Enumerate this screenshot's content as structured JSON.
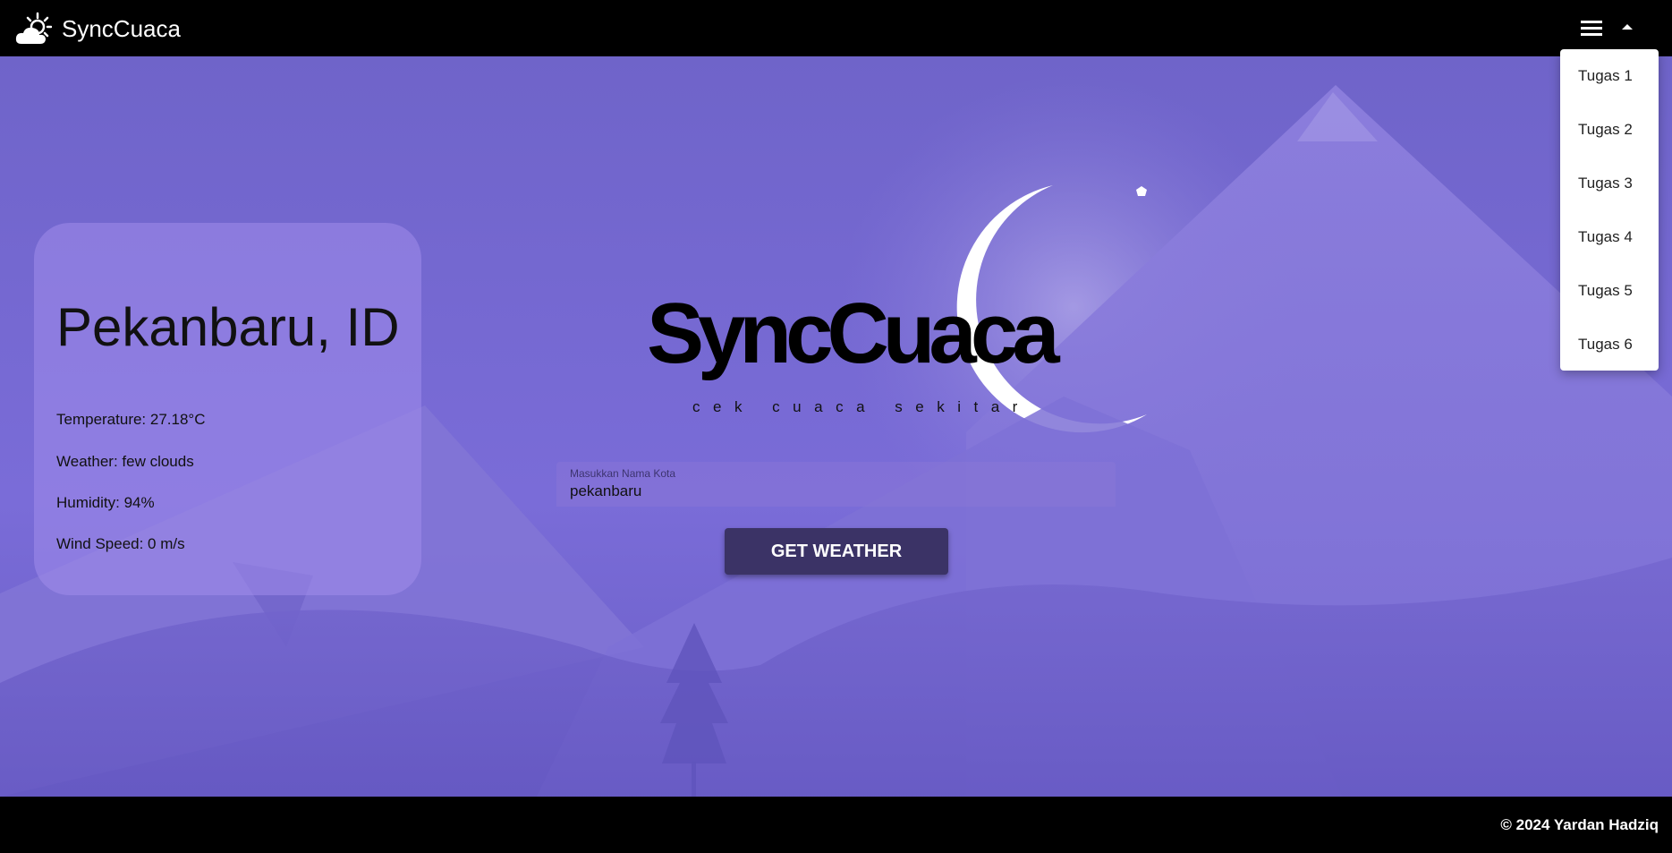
{
  "navbar": {
    "brand_name": "SyncCuaca",
    "brand_icon": "sun-cloud-icon",
    "menu_icon": "hamburger-menu-icon",
    "caret_icon": "caret-up-icon"
  },
  "dropdown": {
    "items": [
      "Tugas 1",
      "Tugas 2",
      "Tugas 3",
      "Tugas 4",
      "Tugas 5",
      "Tugas 6"
    ]
  },
  "weather": {
    "city": "Pekanbaru, ID",
    "temperature": "Temperature: 27.18°C",
    "description": "Weather: few clouds",
    "humidity": "Humidity: 94%",
    "wind": "Wind Speed: 0 m/s"
  },
  "logo": {
    "title": "SyncCuaca",
    "tagline": "cek cuaca sekitar"
  },
  "search": {
    "label": "Masukkan Nama Kota",
    "value": "pekanbaru"
  },
  "button": {
    "label": "GET WEATHER"
  },
  "footer": {
    "text": "© 2024 Yardan Hadziq"
  },
  "colors": {
    "background": "#7467c9",
    "bar": "#000000",
    "button": "#3b3366"
  }
}
